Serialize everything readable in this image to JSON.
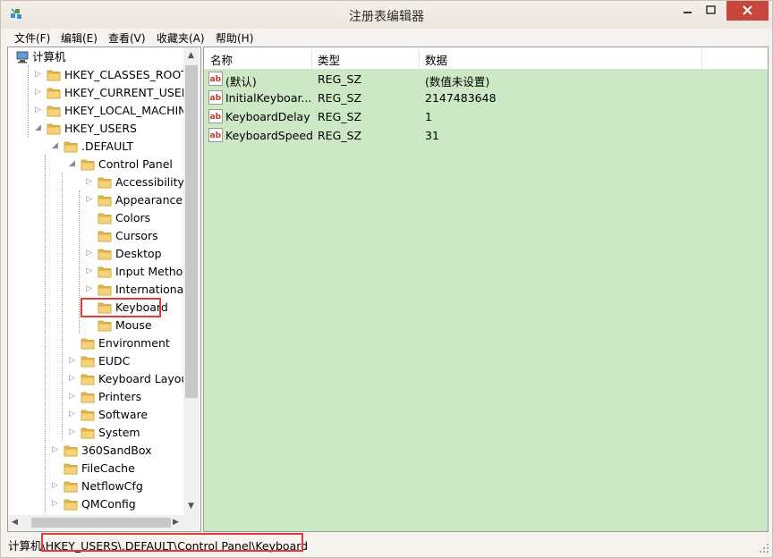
{
  "window": {
    "title": "注册表编辑器",
    "close_icon": "close-icon",
    "maximize_icon": "maximize-icon",
    "minimize_icon": "minimize-icon"
  },
  "menu": [
    "文件(F)",
    "编辑(E)",
    "查看(V)",
    "收藏夹(A)",
    "帮助(H)"
  ],
  "tree": {
    "root": "计算机",
    "hives": [
      "HKEY_CLASSES_ROOT",
      "HKEY_CURRENT_USER",
      "HKEY_LOCAL_MACHINE",
      "HKEY_USERS"
    ],
    "default": ".DEFAULT",
    "control_panel": "Control Panel",
    "cp_children": [
      "Accessibility",
      "Appearance",
      "Colors",
      "Cursors",
      "Desktop",
      "Input Method",
      "International",
      "Keyboard",
      "Mouse"
    ],
    "default_children": [
      "Environment",
      "EUDC",
      "Keyboard Layout",
      "Printers",
      "Software",
      "System"
    ],
    "users_children": [
      "360SandBox",
      "FileCache",
      "NetflowCfg",
      "QMConfig"
    ],
    "selected": "Keyboard"
  },
  "list": {
    "columns": [
      "名称",
      "类型",
      "数据"
    ],
    "rows": [
      {
        "name": "(默认)",
        "type": "REG_SZ",
        "data": "(数值未设置)",
        "icon": "string-value-icon"
      },
      {
        "name": "InitialKeyboar...",
        "type": "REG_SZ",
        "data": "2147483648",
        "icon": "string-value-icon"
      },
      {
        "name": "KeyboardDelay",
        "type": "REG_SZ",
        "data": "1",
        "icon": "string-value-icon"
      },
      {
        "name": "KeyboardSpeed",
        "type": "REG_SZ",
        "data": "31",
        "icon": "string-value-icon"
      }
    ],
    "background_color": "#cde8c5"
  },
  "status": {
    "prefix": "计算机",
    "path": "\\HKEY_USERS\\.DEFAULT\\Control Panel\\Keyboard"
  },
  "colors": {
    "highlight_border": "#e13b3b",
    "close_button": "#c7473c"
  }
}
